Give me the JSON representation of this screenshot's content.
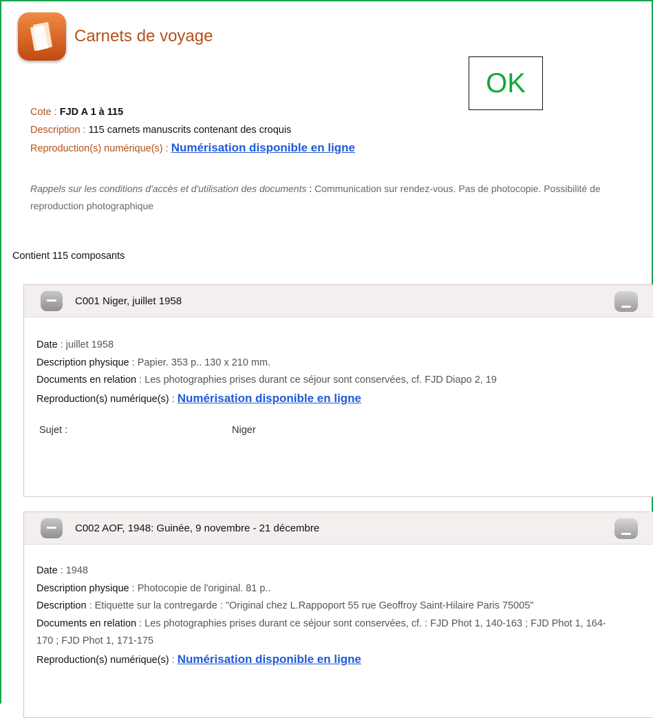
{
  "header": {
    "title": "Carnets de voyage",
    "icon": "book-sketch-icon"
  },
  "ok_label": "OK",
  "record": {
    "cote_label": "Cote",
    "cote_value": "FJD A 1 à 115",
    "description_label": "Description",
    "description_value": "115 carnets manuscrits contenant des croquis",
    "repro_label": "Reproduction(s) numérique(s)",
    "repro_link": "Numérisation disponible en ligne"
  },
  "rappels": {
    "label": "Rappels sur les conditions d'accès et d'utilisation des documents",
    "text": "Communication sur rendez-vous. Pas de photocopie. Possibilité de reproduction photographique"
  },
  "components_count": "Contient 115 composants",
  "components": [
    {
      "title": "C001  Niger, juillet 1958",
      "date_label": "Date",
      "date_value": "juillet 1958",
      "phys_label": "Description physique",
      "phys_value": "Papier. 353 p.. 130 x 210 mm.",
      "rel_label": "Documents en relation",
      "rel_value": "Les photographies prises durant ce séjour sont conservées, cf. FJD Diapo 2, 19",
      "repro_label": "Reproduction(s) numérique(s)",
      "repro_link": "Numérisation disponible en ligne",
      "sujet_label": "Sujet :",
      "sujet_value": "Niger"
    },
    {
      "title": "C002  AOF, 1948: Guinée, 9 novembre - 21 décembre",
      "date_label": "Date",
      "date_value": "1948",
      "phys_label": "Description physique",
      "phys_value": "Photocopie de l'original. 81 p..",
      "desc_label": "Description",
      "desc_value": "Etiquette sur la contregarde : \"Original chez L.Rappoport 55 rue Geoffroy Saint-Hilaire Paris 75005\"",
      "rel_label": "Documents en relation",
      "rel_value": "Les photographies prises durant ce séjour sont conservées, cf. : FJD Phot 1, 140-163 ; FJD Phot 1, 164-170 ; FJD Phot 1, 171-175",
      "repro_label": "Reproduction(s) numérique(s)",
      "repro_link": "Numérisation disponible en ligne"
    }
  ]
}
